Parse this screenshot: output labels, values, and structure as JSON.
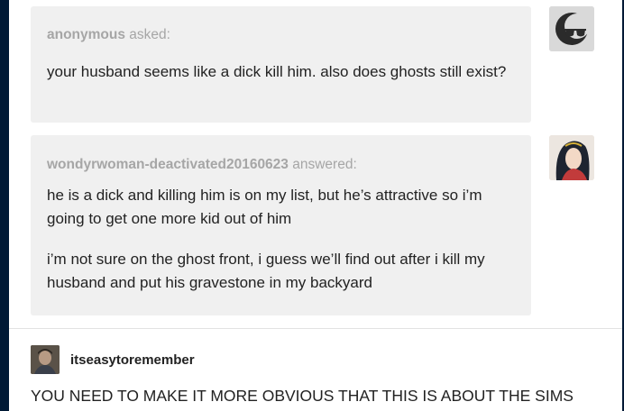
{
  "ask": {
    "asker": "anonymous",
    "verb": "asked:",
    "question": "your husband seems like a dick kill him. also does ghosts still exist?"
  },
  "answer": {
    "username": "wondyrwoman-deactivated20160623",
    "verb": "answered:",
    "paragraphs": [
      "he is a dick and killing him is on my list, but he’s attractive so i’m going to get one more kid out of him",
      "i’m not sure on the ghost front, i guess we’ll find out after i kill my husband and put his gravestone in my backyard"
    ]
  },
  "reblog": {
    "username": "itseasytoremember",
    "text": "YOU NEED TO MAKE IT MORE OBVIOUS THAT THIS IS ABOUT THE SIMS"
  },
  "colors": {
    "background": "#001935",
    "bubble": "#f0f0f0",
    "meta_text": "#a6a6a6"
  }
}
